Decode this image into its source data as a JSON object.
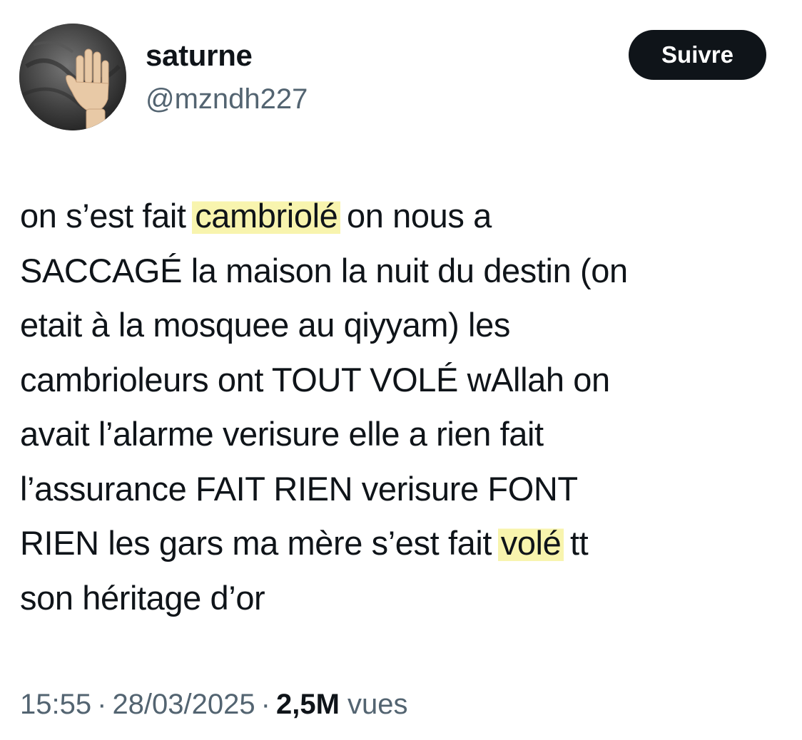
{
  "tweet": {
    "author": {
      "display_name": "saturne",
      "handle": "@mzndh227",
      "avatar_icon": "raised-hand-avatar"
    },
    "follow_label": "Suivre",
    "text_lines": [
      "on s’est fait ",
      "cambriolé",
      " on nous a",
      "SACCAGÉ la maison la nuit du destin (on",
      "etait à la mosquee au qiyyam) les",
      "cambrioleurs ont TOUT VOLÉ wAllah on",
      "avait l’alarme verisure elle a rien fait",
      "l’assurance FAIT RIEN verisure FONT",
      "RIEN les gars ma mère s’est fait ",
      "volé",
      " tt",
      "son héritage d’or"
    ],
    "highlight_color": "#f8f4aa",
    "time": "15:55",
    "separator": "·",
    "date": "28/03/2025",
    "views_count": "2,5M",
    "views_label": "vues"
  }
}
